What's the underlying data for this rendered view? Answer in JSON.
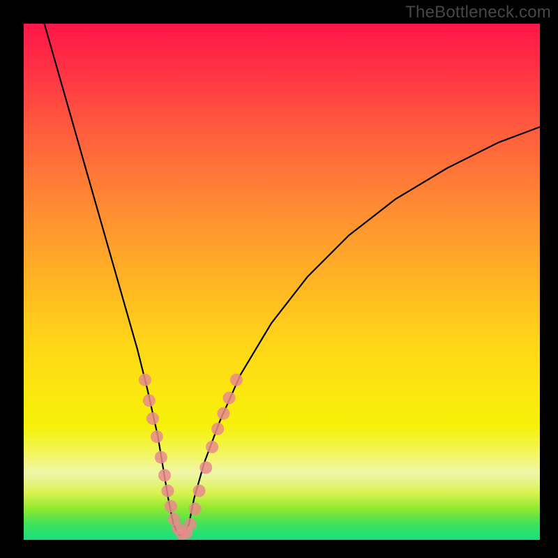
{
  "watermark": "TheBottleneck.com",
  "colors": {
    "frame": "#000000",
    "curve": "#000000",
    "marker": "#e88b8b",
    "gradient_top": "#ff1649",
    "gradient_bottom": "#17df81"
  },
  "chart_data": {
    "type": "line",
    "title": "",
    "xlabel": "",
    "ylabel": "",
    "xlim": [
      0,
      100
    ],
    "ylim": [
      0,
      100
    ],
    "grid": false,
    "legend": false,
    "notes": "V-shaped bottleneck curve with pink markers clustered near the trough on both branches. Y decreases toward the minimum and rises again; background gradient encodes severity (red high, green low). No numeric axis labels shown.",
    "series": [
      {
        "name": "bottleneck-curve",
        "x": [
          4,
          8,
          12,
          16,
          20,
          22,
          24,
          26,
          27,
          28,
          29,
          30,
          31,
          32,
          33,
          35,
          38,
          42,
          48,
          55,
          63,
          72,
          82,
          92,
          100
        ],
        "y": [
          100,
          86,
          72,
          58,
          44,
          37,
          29,
          20,
          14,
          8,
          3,
          1,
          1,
          3,
          8,
          15,
          23,
          32,
          42,
          51,
          59,
          66,
          72,
          77,
          80
        ]
      }
    ],
    "markers": [
      {
        "x": 23.5,
        "y": 31
      },
      {
        "x": 24.3,
        "y": 27
      },
      {
        "x": 25.0,
        "y": 23.5
      },
      {
        "x": 25.8,
        "y": 20
      },
      {
        "x": 26.6,
        "y": 16
      },
      {
        "x": 27.3,
        "y": 12.5
      },
      {
        "x": 27.9,
        "y": 9.5
      },
      {
        "x": 28.5,
        "y": 6.5
      },
      {
        "x": 29.1,
        "y": 4
      },
      {
        "x": 29.9,
        "y": 2.2
      },
      {
        "x": 30.7,
        "y": 1.2
      },
      {
        "x": 31.5,
        "y": 1.4
      },
      {
        "x": 32.3,
        "y": 3
      },
      {
        "x": 33.2,
        "y": 6
      },
      {
        "x": 34.0,
        "y": 9.5
      },
      {
        "x": 35.3,
        "y": 14
      },
      {
        "x": 36.5,
        "y": 18
      },
      {
        "x": 37.6,
        "y": 21.5
      },
      {
        "x": 38.7,
        "y": 24.5
      },
      {
        "x": 39.8,
        "y": 27.5
      },
      {
        "x": 41.2,
        "y": 31
      }
    ]
  }
}
